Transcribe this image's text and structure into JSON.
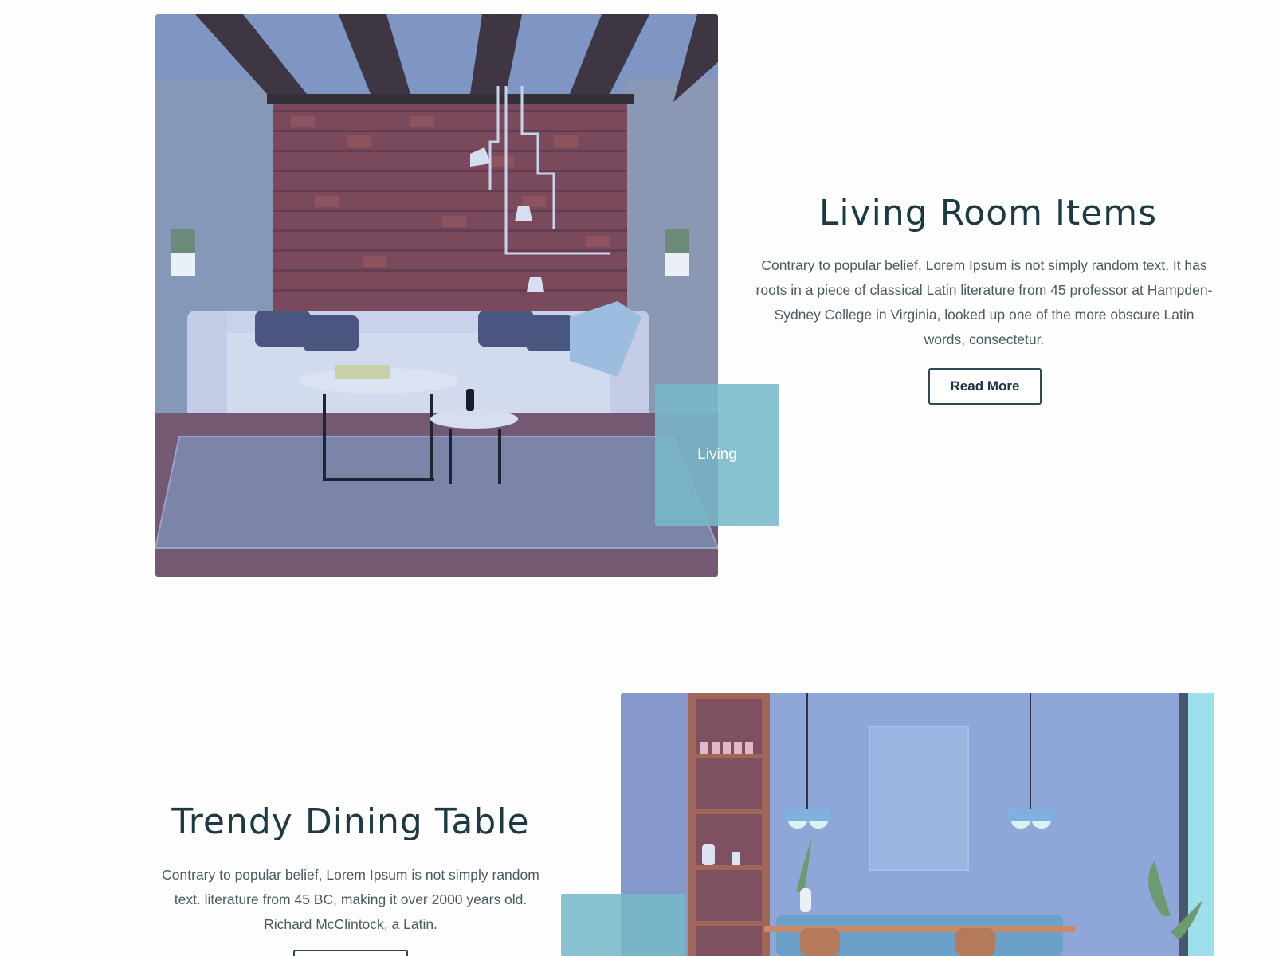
{
  "living": {
    "title": "Living Room Items",
    "description": "Contrary to popular belief, Lorem Ipsum is not simply random text. It has roots in a piece of classical Latin literature from 45 professor at Hampden-Sydney College in Virginia, looked up one of the more obscure Latin words, consectetur.",
    "button_label": "Read More",
    "tag_label": "Living"
  },
  "dining": {
    "title": "Trendy Dining Table",
    "description": "Contrary to popular belief, Lorem Ipsum is not simply random text. literature from 45 BC, making it over 2000 years old. Richard McClintock, a Latin.",
    "button_label": ""
  },
  "colors": {
    "accent_overlay": "#78b8c8",
    "heading": "#1d3a44",
    "body_text": "#4a5a62",
    "button_border": "#2c4a55"
  }
}
